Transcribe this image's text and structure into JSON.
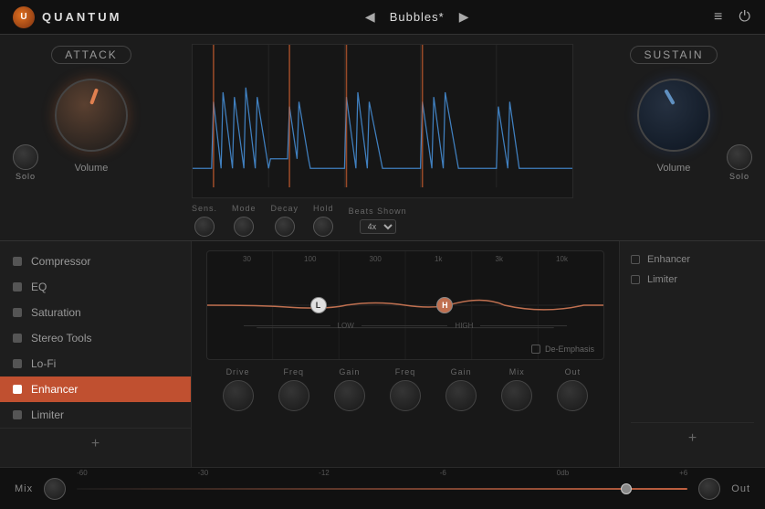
{
  "topBar": {
    "logoText": "U",
    "appTitle": "QUANTUM",
    "prevArrow": "◀",
    "nextArrow": "▶",
    "presetName": "Bubbles*",
    "menuIcon": "≡",
    "powerIcon": "⏻"
  },
  "attackPanel": {
    "title": "Attack",
    "soloLabel": "Solo",
    "volumeLabel": "Volume"
  },
  "sustainPanel": {
    "title": "Sustain",
    "soloLabel": "Solo",
    "volumeLabel": "Volume"
  },
  "waveformControls": {
    "sensLabel": "Sens.",
    "modeLabel": "Mode",
    "decayLabel": "Decay",
    "holdLabel": "Hold",
    "beatsShownLabel": "Beats Shown",
    "beatsValue": "4x"
  },
  "sidebar": {
    "items": [
      {
        "id": "compressor",
        "label": "Compressor",
        "active": false
      },
      {
        "id": "eq",
        "label": "EQ",
        "active": false
      },
      {
        "id": "saturation",
        "label": "Saturation",
        "active": false
      },
      {
        "id": "stereo-tools",
        "label": "Stereo Tools",
        "active": false
      },
      {
        "id": "lo-fi",
        "label": "Lo-Fi",
        "active": false
      },
      {
        "id": "enhancer",
        "label": "Enhancer",
        "active": true
      },
      {
        "id": "limiter",
        "label": "Limiter",
        "active": false
      }
    ],
    "addLabel": "+"
  },
  "eqDisplay": {
    "freqLabels": [
      "30",
      "100",
      "300",
      "1k",
      "3k",
      "10k"
    ],
    "lowLabel": "LOW",
    "highLabel": "HIGH",
    "deEmphasisLabel": "De-Emphasis"
  },
  "eqKnobs": [
    {
      "id": "drive",
      "label": "Drive"
    },
    {
      "id": "freq-low",
      "label": "Freq"
    },
    {
      "id": "gain-low",
      "label": "Gain"
    },
    {
      "id": "freq-high",
      "label": "Freq"
    },
    {
      "id": "gain-high",
      "label": "Gain"
    },
    {
      "id": "mix",
      "label": "Mix"
    },
    {
      "id": "out",
      "label": "Out"
    }
  ],
  "rightPanel": {
    "items": [
      {
        "id": "enhancer",
        "label": "Enhancer"
      },
      {
        "id": "limiter",
        "label": "Limiter"
      }
    ],
    "addLabel": "+"
  },
  "bottomBar": {
    "mixLabel": "Mix",
    "outLabel": "Out",
    "sliderMarks": [
      "-60",
      "-30",
      "-12",
      "-6",
      "0db",
      "+6"
    ]
  }
}
